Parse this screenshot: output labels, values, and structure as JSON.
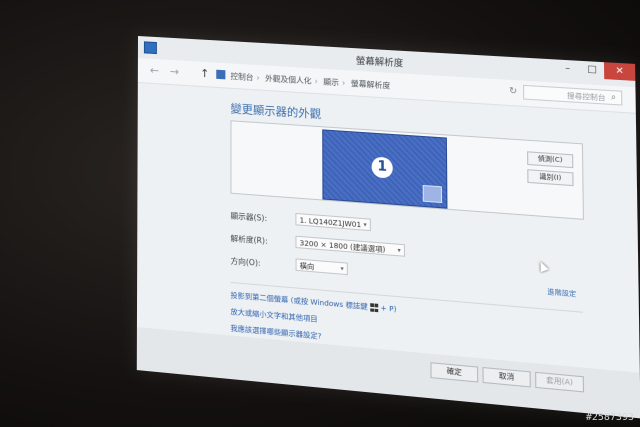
{
  "window": {
    "title": "螢幕解析度",
    "minimize": "–",
    "maximize": "□",
    "close": "✕"
  },
  "nav": {
    "back": "←",
    "forward": "→",
    "up": "↑",
    "breadcrumbs": [
      "控制台",
      "外觀及個人化",
      "顯示",
      "螢幕解析度"
    ],
    "search_placeholder": "搜尋控制台"
  },
  "main": {
    "heading": "變更顯示器的外觀",
    "monitor_number": "1",
    "detect_label": "偵測(C)",
    "identify_label": "識別(I)",
    "display_label": "顯示器(S):",
    "display_value": "1. LQ140Z1JW01",
    "resolution_label": "解析度(R):",
    "resolution_value": "3200 × 1800 (建議選項)",
    "orientation_label": "方向(O):",
    "orientation_value": "橫向",
    "advanced_link": "進階設定"
  },
  "links": {
    "project_prefix": "投影到第二個螢幕 (或按 Windows 標誌鍵",
    "project_suffix": "+ P)",
    "text_size": "放大或縮小文字和其他項目",
    "which_settings": "我應該選擇哪些顯示器設定?"
  },
  "footer": {
    "ok": "確定",
    "cancel": "取消",
    "apply": "套用(A)"
  },
  "watermark": "#2587393"
}
